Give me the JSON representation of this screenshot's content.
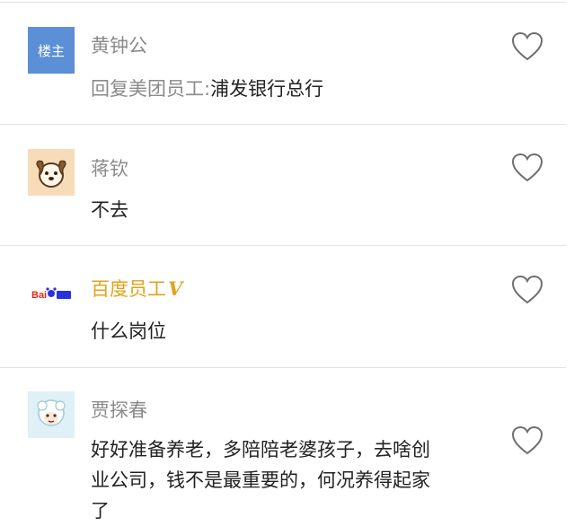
{
  "comments": [
    {
      "avatar_label": "楼主",
      "name": "黄钟公",
      "reply_prefix": "回复美团员工:",
      "text": "浦发银行总行",
      "avatar_icon": "floor-owner-badge",
      "like_icon": "heart-outline-icon"
    },
    {
      "name": "蒋钦",
      "text": "不去",
      "avatar_icon": "dog-avatar-icon",
      "like_icon": "heart-outline-icon"
    },
    {
      "avatar_label": "Bai百度",
      "name": "百度员工",
      "verified_badge": "V",
      "text": "什么岗位",
      "avatar_icon": "baidu-logo-icon",
      "like_icon": "heart-outline-icon"
    },
    {
      "name": "贾探春",
      "text_lines": [
        "好好准备养老，多陪陪老婆孩子，去啥创",
        "业公司，钱不是最重要的，何况养得起家",
        "了"
      ],
      "avatar_icon": "sheep-avatar-icon",
      "like_icon": "heart-outline-icon"
    }
  ],
  "colors": {
    "name_gray": "#8a8a8a",
    "text_dark": "#222222",
    "vip_gold": "#e2a21b",
    "owner_badge_blue": "#5b8fd6",
    "divider": "#e3e3e3"
  }
}
